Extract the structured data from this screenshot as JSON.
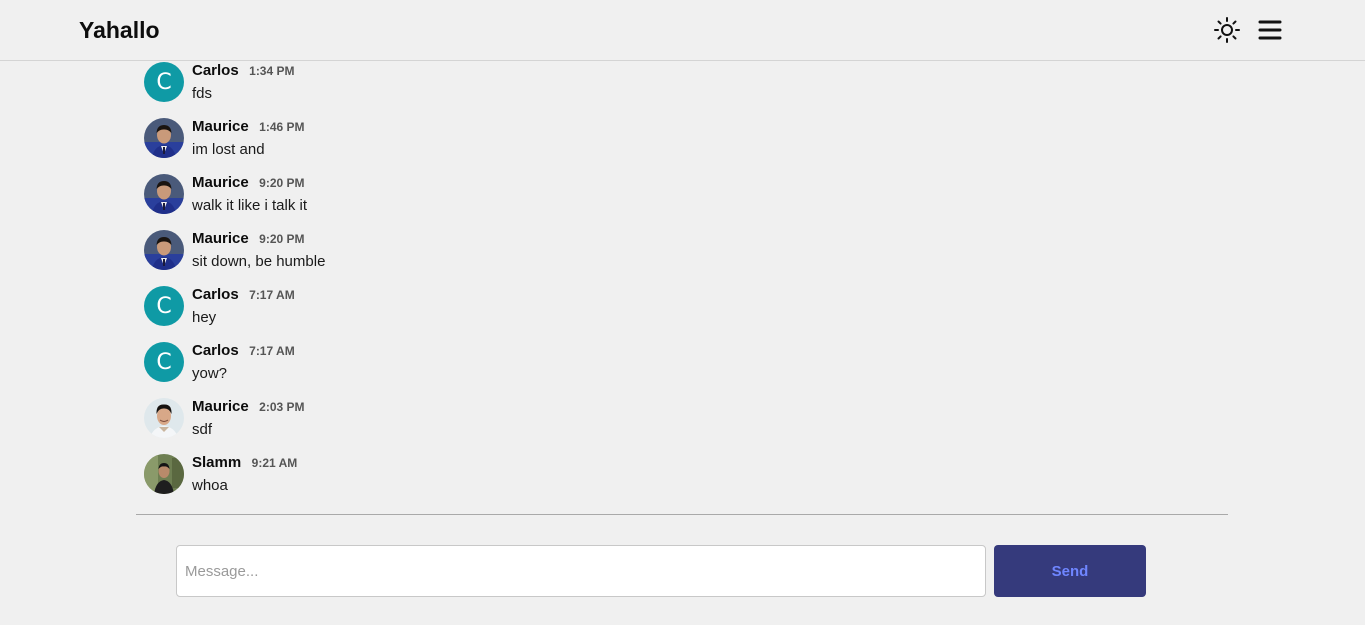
{
  "header": {
    "title": "Yahallo",
    "theme_icon": "sun-icon",
    "menu_icon": "hamburger-menu-icon"
  },
  "colors": {
    "background": "#f0f0f0",
    "letter_avatar": "#0f9aa5",
    "send_button_bg": "#353a7c",
    "send_button_text": "#6f86ff"
  },
  "messages": [
    {
      "name": "Carlos",
      "time": "1:34 PM",
      "text": "fds",
      "avatar": {
        "type": "letter",
        "letter": "C"
      }
    },
    {
      "name": "Maurice",
      "time": "1:46 PM",
      "text": "im lost and",
      "avatar": {
        "type": "photo"
      }
    },
    {
      "name": "Maurice",
      "time": "9:20 PM",
      "text": "walk it like i talk it",
      "avatar": {
        "type": "photo"
      }
    },
    {
      "name": "Maurice",
      "time": "9:20 PM",
      "text": "sit down, be humble",
      "avatar": {
        "type": "photo"
      }
    },
    {
      "name": "Carlos",
      "time": "7:17 AM",
      "text": "hey",
      "avatar": {
        "type": "letter",
        "letter": "C"
      }
    },
    {
      "name": "Carlos",
      "time": "7:17 AM",
      "text": "yow?",
      "avatar": {
        "type": "letter",
        "letter": "C"
      }
    },
    {
      "name": "Maurice",
      "time": "2:03 PM",
      "text": "sdf",
      "avatar": {
        "type": "photo"
      }
    },
    {
      "name": "Slamm",
      "time": "9:21 AM",
      "text": "whoa",
      "avatar": {
        "type": "photo"
      }
    }
  ],
  "composer": {
    "value": "",
    "placeholder": "Message...",
    "send_label": "Send"
  }
}
